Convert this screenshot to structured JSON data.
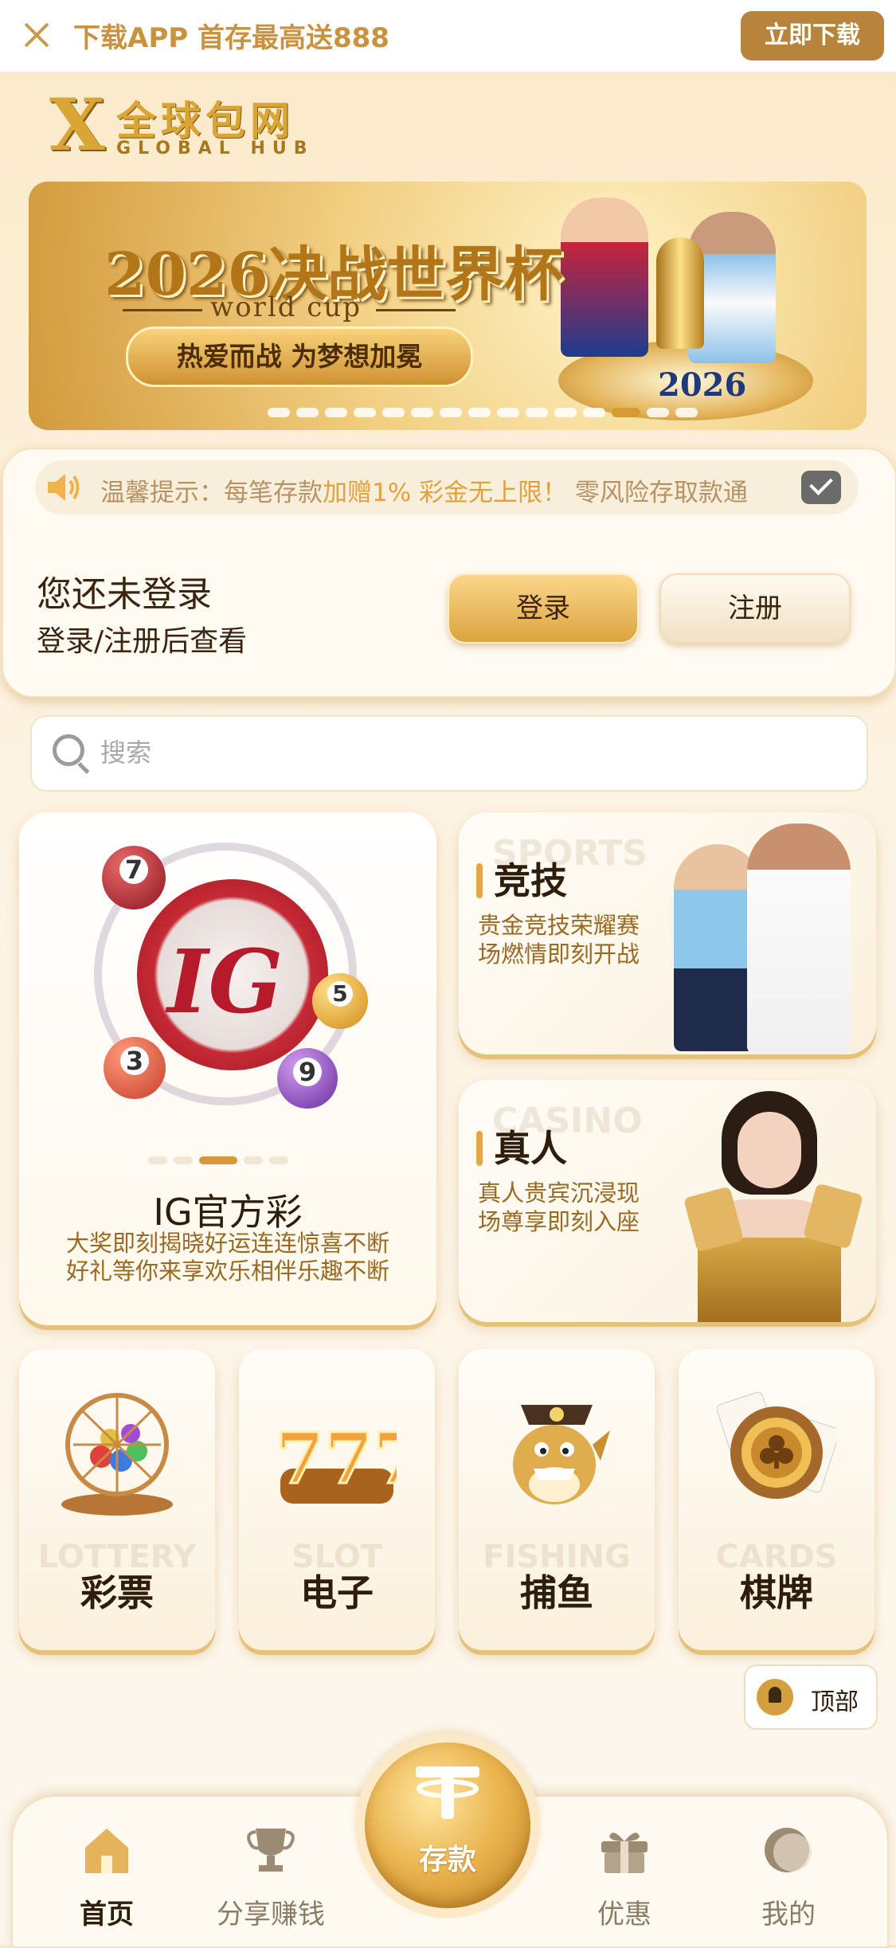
{
  "top_bar": {
    "promo_text": "下载APP 首存最高送888",
    "download_label": "立即下载"
  },
  "logo": {
    "mark": "X",
    "name_cn": "全球包网",
    "name_en": "GLOBAL HUB"
  },
  "banner": {
    "title": "2026决战世界杯",
    "subtitle": "world cup",
    "slogan": "热爱而战 为梦想加冕",
    "badge_text": "2026",
    "slide_count": 15,
    "active_slide": 13
  },
  "notice": {
    "prefix": "温馨提示：",
    "text_before": "每笔存款",
    "highlight": "加赠1% 彩金无上限！",
    "text_after": " 零风险存取款通"
  },
  "login": {
    "title": "您还未登录",
    "subtitle": "登录/注册后查看",
    "login_label": "登录",
    "register_label": "注册"
  },
  "search": {
    "placeholder": "搜索"
  },
  "featured": {
    "ig": {
      "logo_text": "IG",
      "title": "IG官方彩",
      "desc_line1": "大奖即刻揭晓好运连连惊喜不断",
      "desc_line2": "好礼等你来享欢乐相伴乐趣不断",
      "balls": [
        "7",
        "5",
        "3",
        "9"
      ],
      "slide_count": 5,
      "active_slide": 3
    },
    "sports": {
      "en": "SPORTS",
      "title": "竞技",
      "desc": "贵金竞技荣耀赛场燃情即刻开战"
    },
    "casino": {
      "en": "CASINO",
      "title": "真人",
      "desc": "真人贵宾沉浸现场尊享即刻入座"
    }
  },
  "categories": [
    {
      "en": "LOTTERY",
      "label": "彩票",
      "icon": "lottery-cage-icon"
    },
    {
      "en": "SLOT",
      "label": "电子",
      "icon": "slot-777-icon"
    },
    {
      "en": "FISHING",
      "label": "捕鱼",
      "icon": "shark-pirate-icon"
    },
    {
      "en": "CARDS",
      "label": "棋牌",
      "icon": "poker-chip-icon"
    }
  ],
  "back_to_top": {
    "label": "顶部"
  },
  "bottom_nav": {
    "home": "首页",
    "share": "分享赚钱",
    "deposit": "存款",
    "promo": "优惠",
    "mine": "我的"
  },
  "colors": {
    "accent": "#d9a534",
    "brand_brown": "#b8843b",
    "active_dot": "#d39a37"
  }
}
